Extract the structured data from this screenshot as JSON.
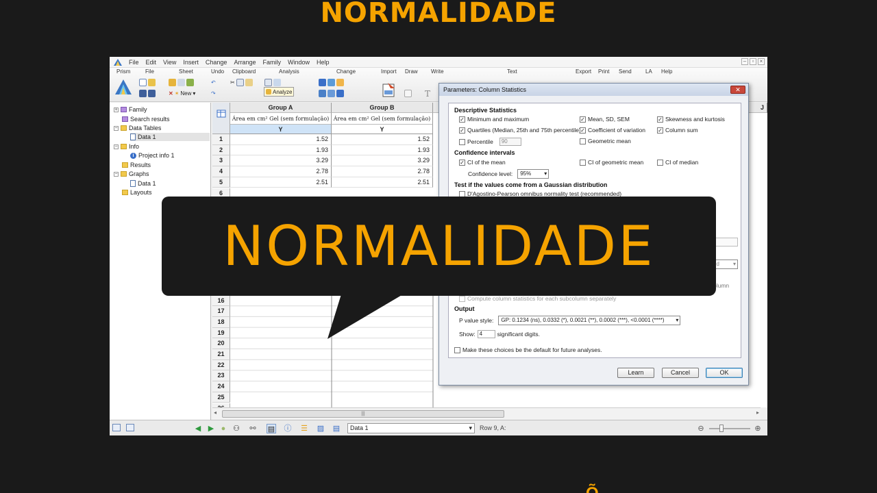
{
  "banner": {
    "top_title": "NORMALIDADE",
    "bubble_title": "NORMALIDADE",
    "bottom_partial": "Õ"
  },
  "menu": [
    "File",
    "Edit",
    "View",
    "Insert",
    "Change",
    "Arrange",
    "Family",
    "Window",
    "Help"
  ],
  "ribbon": {
    "groups": [
      "Prism",
      "File",
      "Sheet",
      "Undo",
      "Clipboard",
      "Analysis",
      "Change",
      "Import",
      "Draw",
      "Write",
      "Text",
      "Export",
      "Print",
      "Send",
      "LA",
      "Help"
    ],
    "new_label": "New",
    "analyze_label": "Analyze"
  },
  "tree": {
    "items": [
      "Family",
      "Search results",
      "Data Tables",
      "Data 1",
      "Info",
      "Project info 1",
      "Results",
      "Graphs",
      "Data 1",
      "Layouts"
    ]
  },
  "sheet": {
    "columns": [
      {
        "group": "Group A",
        "title": "Área em cm² Gel (sem formulação)",
        "sub": "Y"
      },
      {
        "group": "Group B",
        "title": "Área em cm² Gel (sem formulação)",
        "sub": "Y"
      }
    ],
    "column_j": "J",
    "rows": [
      "1",
      "2",
      "3",
      "4",
      "5",
      "6",
      "16",
      "17",
      "18",
      "19",
      "20",
      "21",
      "22",
      "23",
      "24",
      "25",
      "26"
    ],
    "values_a": [
      "1.52",
      "1.93",
      "3.29",
      "2.78",
      "2.51"
    ],
    "values_b": [
      "1.52",
      "1.93",
      "3.29",
      "2.78",
      "2.51"
    ]
  },
  "status": {
    "sheet_name": "Data 1",
    "cell_position": "Row 9, A:"
  },
  "dialog": {
    "title": "Parameters: Column Statistics",
    "descriptive_heading": "Descriptive Statistics",
    "descriptive": [
      {
        "label": "Minimum and maximum",
        "checked": true
      },
      {
        "label": "Mean, SD, SEM",
        "checked": true
      },
      {
        "label": "Skewness and kurtosis",
        "checked": true
      },
      {
        "label": "Quartiles (Median, 25th and 75th percentile)",
        "checked": true
      },
      {
        "label": "Coefficient of variation",
        "checked": true
      },
      {
        "label": "Column sum",
        "checked": true
      },
      {
        "label": "Percentile",
        "checked": false
      },
      {
        "label": "Geometric mean",
        "checked": false
      }
    ],
    "percentile_value": "90",
    "ci_heading": "Confidence intervals",
    "ci": [
      {
        "label": "CI of the mean",
        "checked": true
      },
      {
        "label": "CI of geometric mean",
        "checked": false
      },
      {
        "label": "CI of median",
        "checked": false
      }
    ],
    "confidence_label": "Confidence level:",
    "confidence_value": "95%",
    "gaussian_heading": "Test if the values come from a Gaussian distribution",
    "gaussian_option": "D'Agostino-Pearson omnibus normality test (recommended)",
    "partial_right_1": "s did",
    "partial_right_2": "olumn",
    "subcolumn_option": "Compute column statistics for each subcolumn separately",
    "output_heading": "Output",
    "pvalue_label": "P value style:",
    "pvalue_value": "GP: 0.1234 (ns), 0.0332 (*), 0.0021 (**), 0.0002 (***), <0.0001 (****)",
    "show_label": "Show:",
    "show_value": "4",
    "digits_label": "significant digits.",
    "default_label": "Make these choices be the default for future analyses.",
    "learn_label": "Learn",
    "cancel_label": "Cancel",
    "ok_label": "OK"
  },
  "colors": {
    "accent": "#f5a300",
    "background": "#1a1a1a"
  }
}
